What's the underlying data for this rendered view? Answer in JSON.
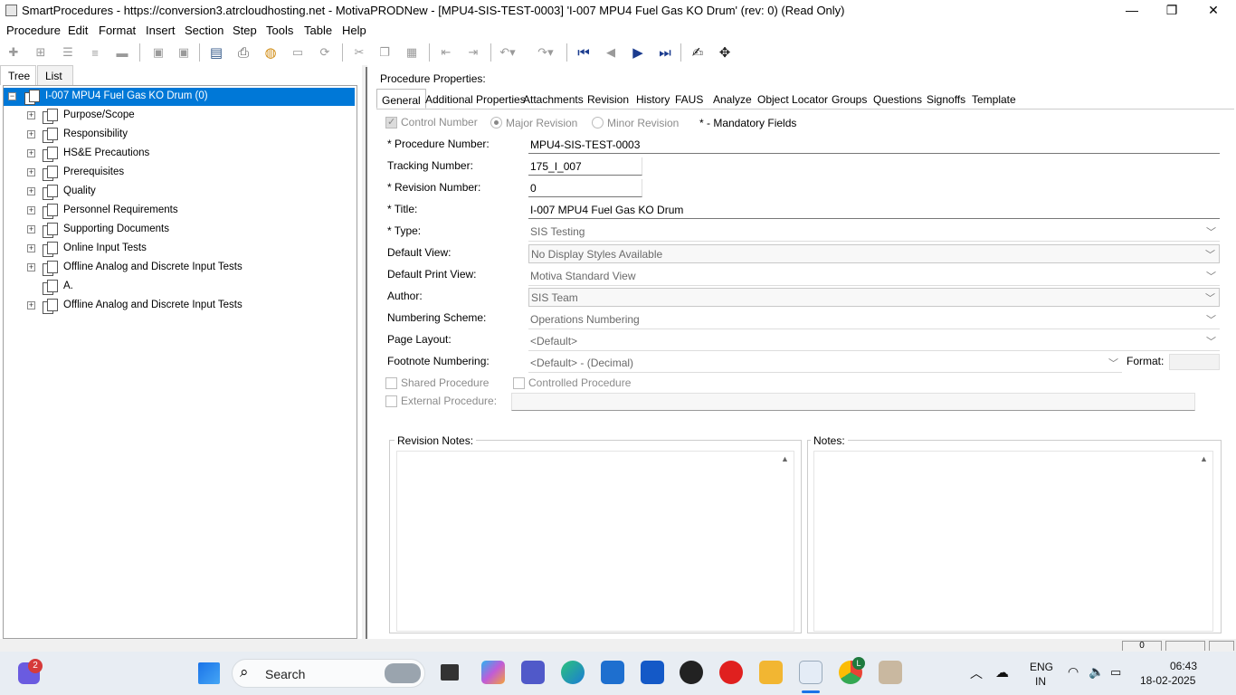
{
  "window": {
    "title": "SmartProcedures - https://conversion3.atrcloudhosting.net - MotivaPRODNew - [MPU4-SIS-TEST-0003] 'I-007 MPU4 Fuel Gas KO Drum' (rev: 0) (Read Only)",
    "minimize": "—",
    "restore": "❐",
    "close": "✕"
  },
  "menu": {
    "procedure": "Procedure",
    "edit": "Edit",
    "format": "Format",
    "insert": "Insert",
    "section": "Section",
    "step": "Step",
    "tools": "Tools",
    "table": "Table",
    "help": "Help"
  },
  "left_tabs": {
    "tree": "Tree",
    "list": "List"
  },
  "tree": {
    "root": "I-007 MPU4 Fuel Gas KO Drum (0)",
    "items": [
      "Purpose/Scope",
      "Responsibility",
      "HS&E Precautions",
      "Prerequisites",
      "Quality",
      "Personnel Requirements",
      "Supporting Documents",
      "Online Input Tests",
      "Offline Analog and Discrete Input Tests",
      "A.",
      "Offline Analog and Discrete Input Tests"
    ]
  },
  "properties": {
    "heading": "Procedure Properties:",
    "tabs": [
      "General",
      "Additional Properties",
      "Attachments",
      "Revision",
      "History",
      "FAUS",
      "Analyze",
      "Object Locator",
      "Groups",
      "Questions",
      "Signoffs",
      "Template"
    ],
    "control_number": "Control Number",
    "major_revision": "Major Revision",
    "minor_revision": "Minor Revision",
    "mandatory_note": "* - Mandatory Fields",
    "procedure_number_label": "* Procedure Number:",
    "procedure_number": "MPU4-SIS-TEST-0003",
    "tracking_number_label": "Tracking Number:",
    "tracking_number": "175_I_007",
    "revision_number_label": "* Revision Number:",
    "revision_number": "0",
    "title_label": "* Title:",
    "title_value": "I-007 MPU4 Fuel Gas KO Drum",
    "type_label": "* Type:",
    "type_value": "SIS Testing",
    "default_view_label": "Default View:",
    "default_view": "No Display Styles Available",
    "default_print_view_label": "Default Print View:",
    "default_print_view": "Motiva Standard View",
    "author_label": "Author:",
    "author": "SIS Team",
    "numbering_scheme_label": "Numbering Scheme:",
    "numbering_scheme": "Operations Numbering",
    "page_layout_label": "Page Layout:",
    "page_layout": "<Default>",
    "footnote_numbering_label": "Footnote Numbering:",
    "footnote_numbering": "<Default> - (Decimal)",
    "format_label": "Format:",
    "shared_procedure": "Shared Procedure",
    "controlled_procedure": "Controlled Procedure",
    "external_procedure": "External Procedure:",
    "revision_notes": "Revision Notes:",
    "notes": "Notes:"
  },
  "statusbar": {
    "cell1": "0"
  },
  "taskbar": {
    "search": "Search",
    "badge": "2",
    "chrome_badge": "L",
    "lang1": "ENG",
    "lang2": "IN",
    "time": "06:43",
    "date": "18-02-2025"
  },
  "colors": {
    "selection": "#0078d7",
    "nav_blue": "#1b3c8f"
  }
}
